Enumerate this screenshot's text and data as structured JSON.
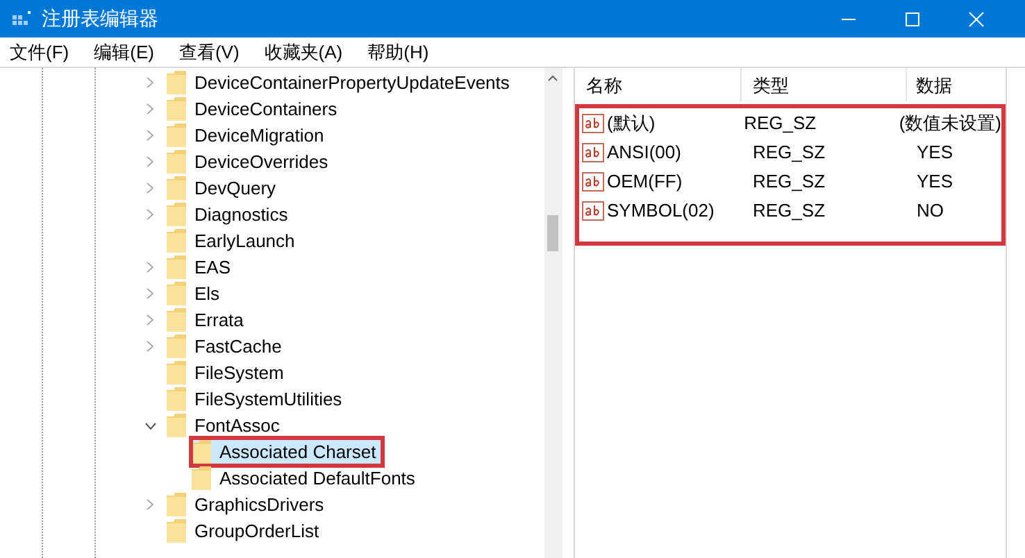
{
  "window": {
    "title": "注册表编辑器"
  },
  "menu": [
    "文件(F)",
    "编辑(E)",
    "查看(V)",
    "收藏夹(A)",
    "帮助(H)"
  ],
  "tree": [
    {
      "kind": "branch",
      "label": "DeviceContainerPropertyUpdateEvents",
      "expanded": false,
      "selected": false
    },
    {
      "kind": "branch",
      "label": "DeviceContainers",
      "expanded": false,
      "selected": false
    },
    {
      "kind": "branch",
      "label": "DeviceMigration",
      "expanded": false,
      "selected": false
    },
    {
      "kind": "branch",
      "label": "DeviceOverrides",
      "expanded": false,
      "selected": false
    },
    {
      "kind": "branch",
      "label": "DevQuery",
      "expanded": false,
      "selected": false
    },
    {
      "kind": "branch",
      "label": "Diagnostics",
      "expanded": false,
      "selected": false
    },
    {
      "kind": "leaf",
      "label": "EarlyLaunch",
      "selected": false
    },
    {
      "kind": "branch",
      "label": "EAS",
      "expanded": false,
      "selected": false
    },
    {
      "kind": "branch",
      "label": "Els",
      "expanded": false,
      "selected": false
    },
    {
      "kind": "branch",
      "label": "Errata",
      "expanded": false,
      "selected": false
    },
    {
      "kind": "branch",
      "label": "FastCache",
      "expanded": false,
      "selected": false
    },
    {
      "kind": "leaf",
      "label": "FileSystem",
      "selected": false
    },
    {
      "kind": "leaf",
      "label": "FileSystemUtilities",
      "selected": false
    },
    {
      "kind": "branch",
      "label": "FontAssoc",
      "expanded": true,
      "selected": false,
      "children": [
        {
          "label": "Associated Charset",
          "selected": true
        },
        {
          "label": "Associated DefaultFonts",
          "selected": false
        }
      ]
    },
    {
      "kind": "branch",
      "label": "GraphicsDrivers",
      "expanded": false,
      "selected": false
    },
    {
      "kind": "leaf",
      "label": "GroupOrderList",
      "selected": false
    }
  ],
  "values": {
    "columns": [
      "名称",
      "类型",
      "数据"
    ],
    "rows": [
      {
        "name": "(默认)",
        "type": "REG_SZ",
        "data": "(数值未设置)"
      },
      {
        "name": "ANSI(00)",
        "type": "REG_SZ",
        "data": "YES"
      },
      {
        "name": "OEM(FF)",
        "type": "REG_SZ",
        "data": "YES"
      },
      {
        "name": "SYMBOL(02)",
        "type": "REG_SZ",
        "data": "NO"
      }
    ]
  }
}
